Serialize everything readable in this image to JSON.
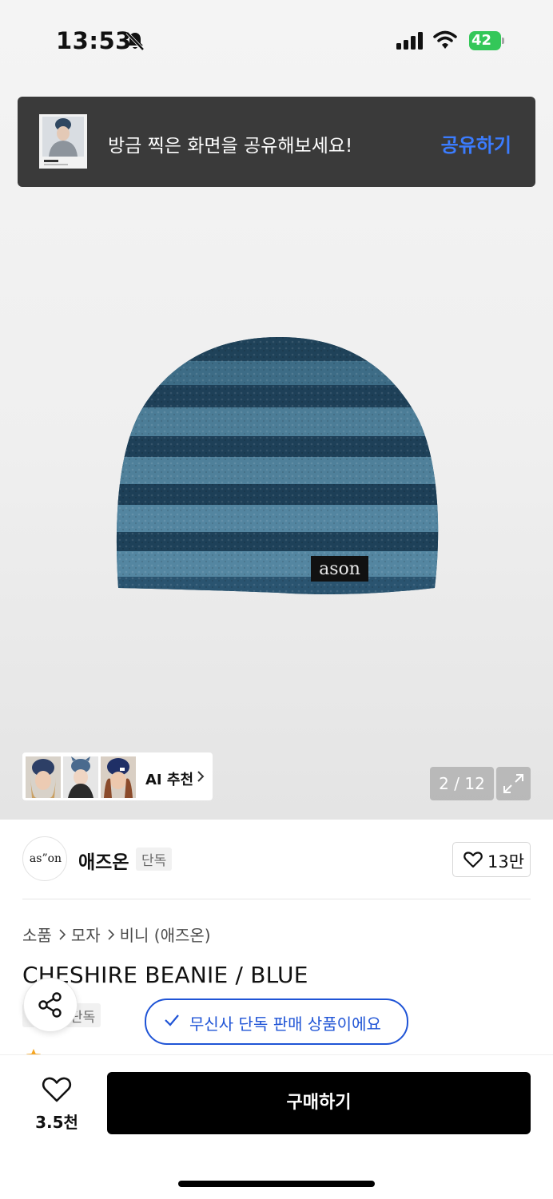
{
  "status_bar": {
    "time": "13:53",
    "battery": "42"
  },
  "share_toast": {
    "message": "방금 찍은 화면을 공유해보세요!",
    "action": "공유하기"
  },
  "gallery": {
    "ai_recommend_label": "AI 추천",
    "page_indicator": "2 / 12",
    "product_logo_text": "ason"
  },
  "brand": {
    "logo_text": "as”on",
    "name": "애즈온",
    "tag": "단독",
    "like_count": "13만"
  },
  "breadcrumb": {
    "items": [
      "소품",
      "모자",
      "비니 (애즈온)"
    ]
  },
  "product": {
    "title": "CHESHIRE BEANIE / BLUE",
    "badge": "단독",
    "exclusive_notice": "무신사 단독 판매 상품이에요"
  },
  "bottom_bar": {
    "wishlist_count": "3.5천",
    "buy_label": "구매하기"
  },
  "colors": {
    "accent_blue": "#1f54d6",
    "toast_link_blue": "#3b7cff",
    "battery_green": "#34c759"
  }
}
